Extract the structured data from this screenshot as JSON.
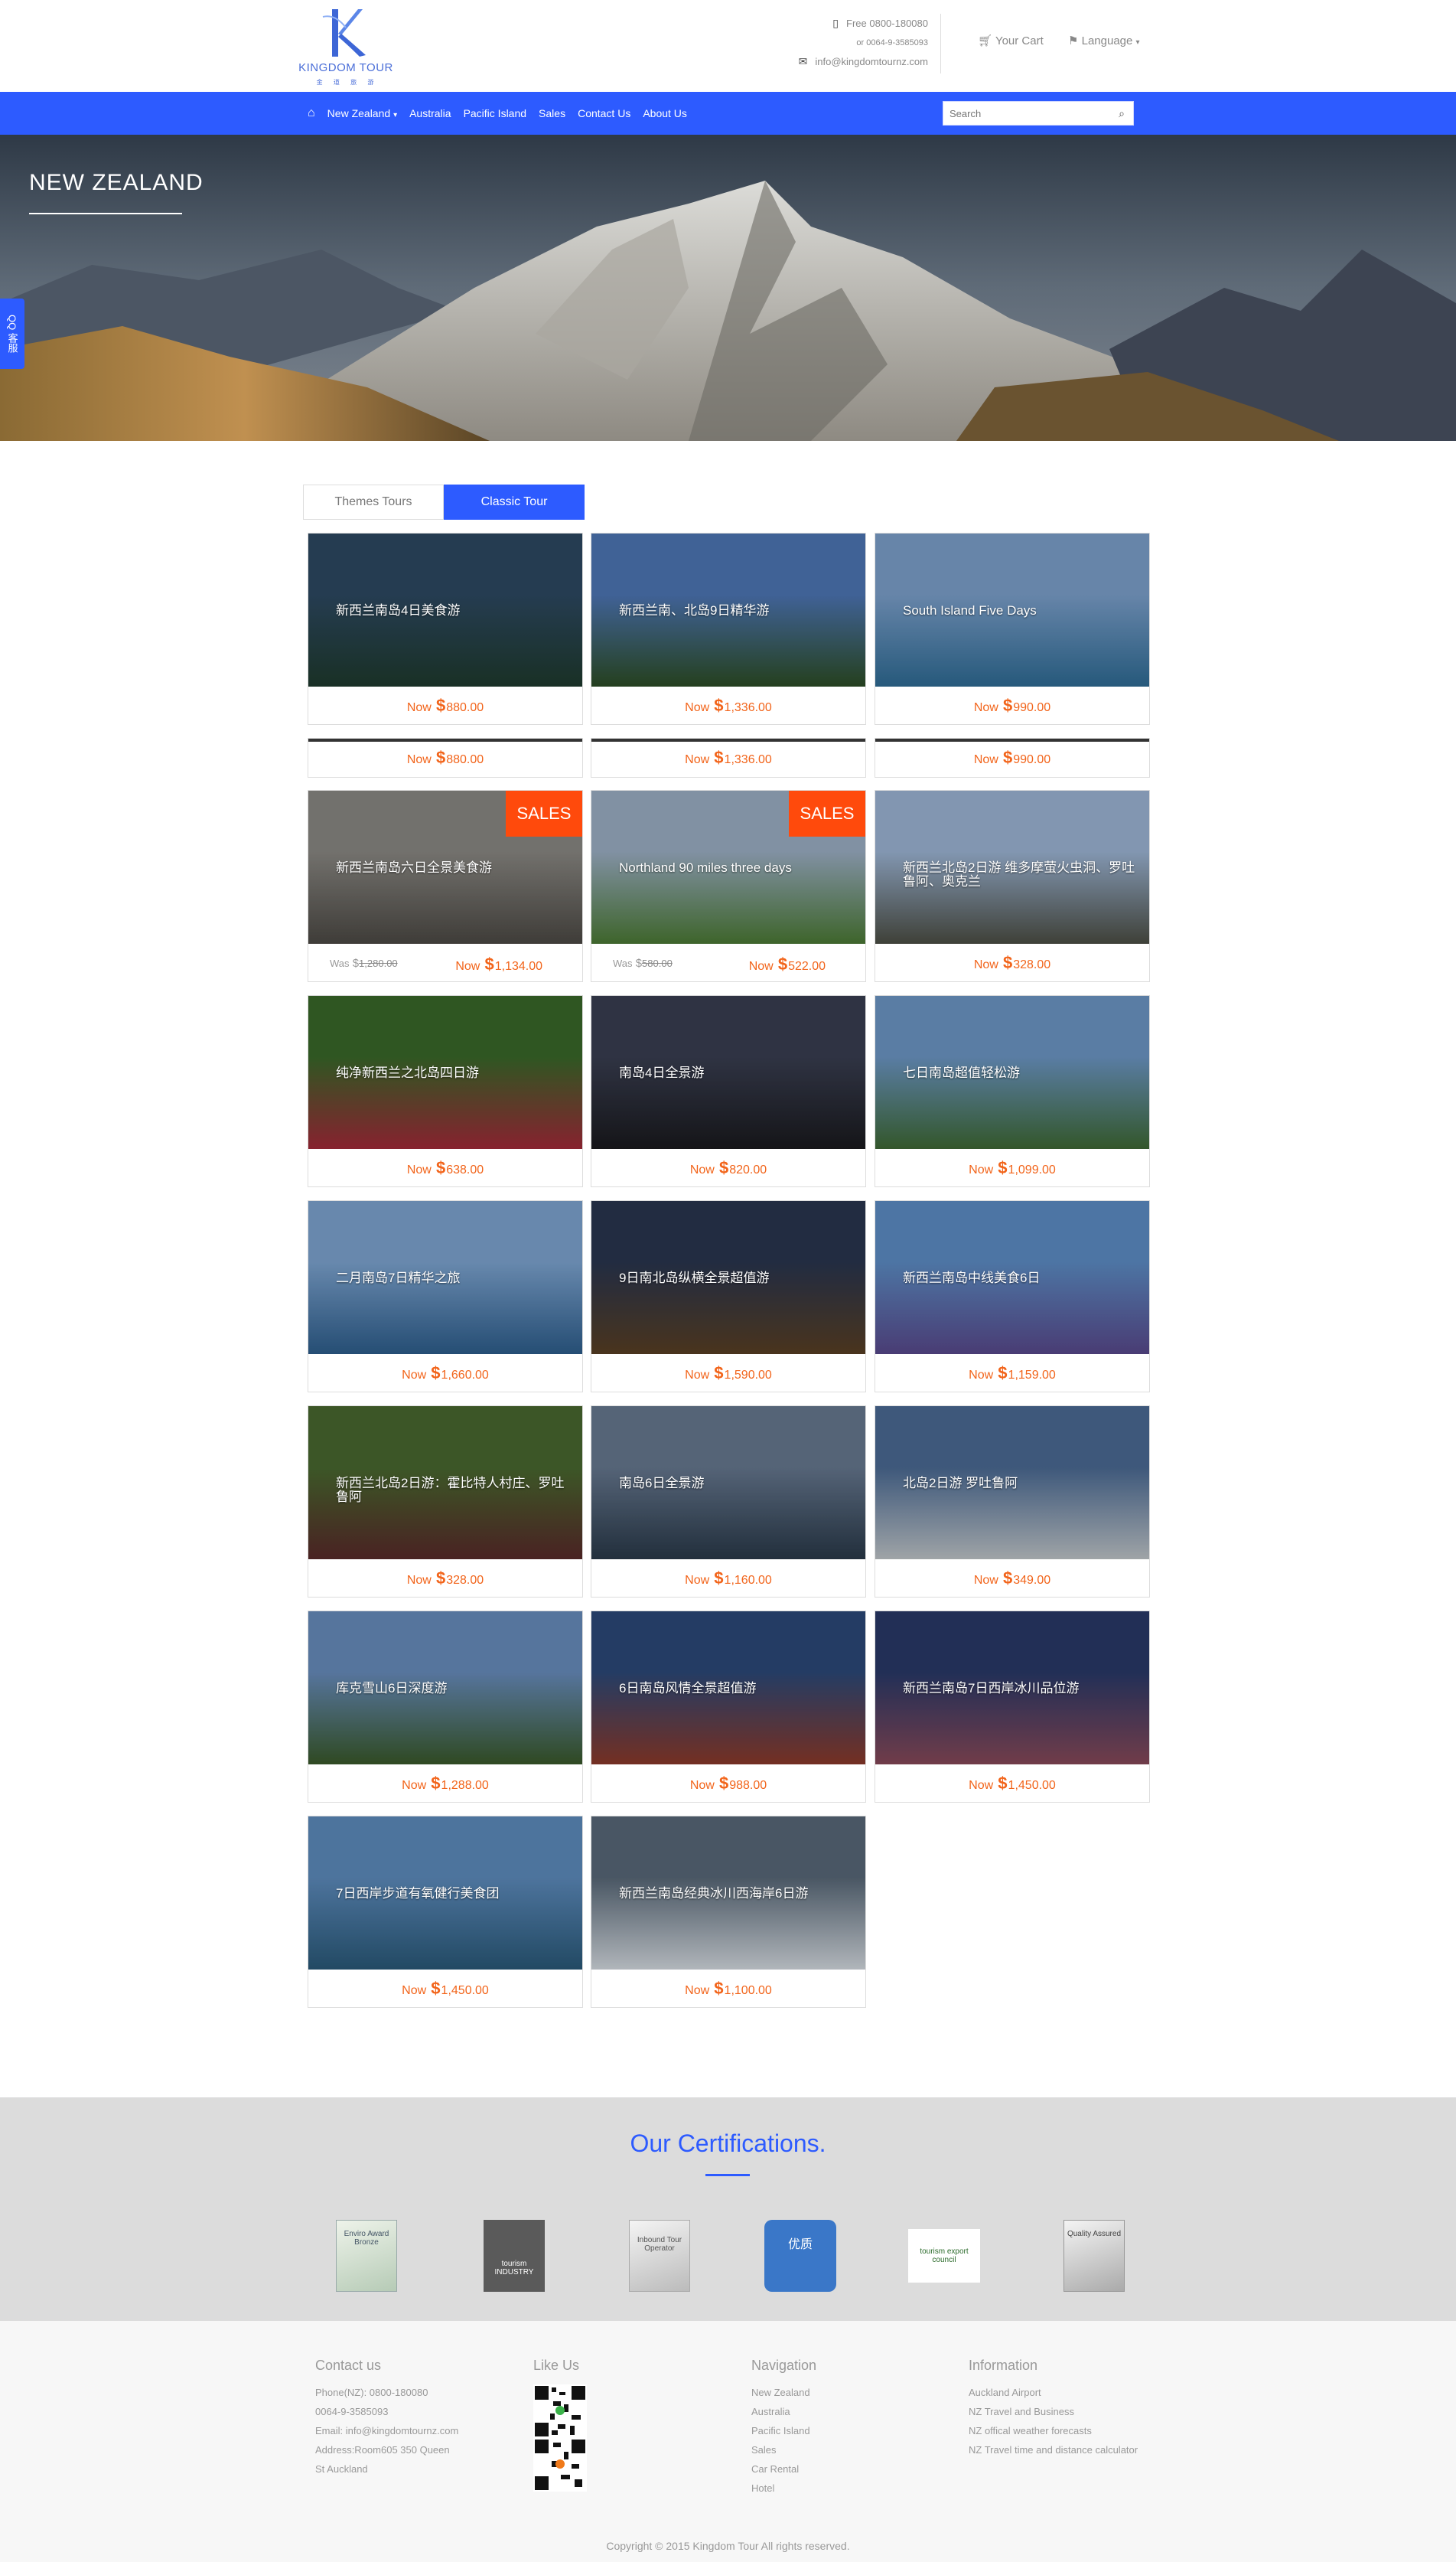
{
  "header": {
    "logo_text": "KINGDOM TOUR",
    "logo_sub": "金 道 旅 游",
    "phone_label": "Free 0800-180080",
    "phone_alt": "or 0064-9-3585093",
    "email": "info@kingdomtournz.com",
    "cart_label": "Your Cart",
    "language_label": "Language"
  },
  "nav": {
    "items": [
      "New Zealand",
      "Australia",
      "Pacific Island",
      "Sales",
      "Contact Us",
      "About Us"
    ],
    "search_placeholder": "Search"
  },
  "hero": {
    "title": "NEW ZEALAND",
    "qq_tab": "QQ 客服"
  },
  "tabs": [
    "Themes Tours",
    "Classic Tour"
  ],
  "price_prefix": "Now",
  "was_prefix": "Was",
  "sales_label": "SALES",
  "tours": [
    {
      "title": "新西兰南岛4日美食游",
      "price": "880.00",
      "colors": [
        "#2e4a63",
        "#1f3b2e"
      ]
    },
    {
      "title": "新西兰南、北岛9日精华游",
      "price": "1,336.00",
      "colors": [
        "#4f78b8",
        "#2d4e25"
      ]
    },
    {
      "title": "South Island Five Days",
      "price": "990.00",
      "colors": [
        "#7ea3cf",
        "#2f6d97"
      ]
    },
    {
      "title": "",
      "price": "880.00",
      "short": true
    },
    {
      "title": "",
      "price": "1,336.00",
      "short": true
    },
    {
      "title": "",
      "price": "990.00",
      "short": true
    },
    {
      "title": "新西兰南岛六日全景美食游",
      "price": "1,134.00",
      "was": "1,280.00",
      "sale": true,
      "colors": [
        "#8c8a85",
        "#4d4a45"
      ]
    },
    {
      "title": "Northland 90 miles three days",
      "price": "522.00",
      "was": "580.00",
      "sale": true,
      "colors": [
        "#9eb1c7",
        "#4c7b35"
      ]
    },
    {
      "title": "新西兰北岛2日游 维多摩萤火虫洞、罗吐鲁阿、奥克兰",
      "price": "328.00",
      "colors": [
        "#9fb8d8",
        "#4d4f45"
      ]
    },
    {
      "title": "纯净新西兰之北岛四日游",
      "price": "638.00",
      "colors": [
        "#3a6a2a",
        "#a52a3a"
      ]
    },
    {
      "title": "南岛4日全景游",
      "price": "820.00",
      "colors": [
        "#3a3f52",
        "#1a1a1e"
      ]
    },
    {
      "title": "七日南岛超值轻松游",
      "price": "1,099.00",
      "colors": [
        "#6e99c8",
        "#3f6a35"
      ]
    },
    {
      "title": "二月南岛7日精华之旅",
      "price": "1,660.00",
      "colors": [
        "#7fa7d4",
        "#2e5f8e"
      ]
    },
    {
      "title": "9日南北岛纵横全景超值游",
      "price": "1,590.00",
      "colors": [
        "#2a3650",
        "#5a4024"
      ]
    },
    {
      "title": "新西兰南岛中线美食6日",
      "price": "1,159.00",
      "colors": [
        "#5e8fc8",
        "#5a4a8e"
      ]
    },
    {
      "title": "新西兰北岛2日游：霍比特人村庄、罗吐鲁阿",
      "price": "328.00",
      "colors": [
        "#4a6a30",
        "#5a2a2a"
      ]
    },
    {
      "title": "南岛6日全景游",
      "price": "1,160.00",
      "colors": [
        "#687a92",
        "#2a3a4a"
      ]
    },
    {
      "title": "北岛2日游 罗吐鲁阿",
      "price": "349.00",
      "colors": [
        "#4c6c96",
        "#c2c8cc"
      ]
    },
    {
      "title": "库克雪山6日深度游",
      "price": "1,288.00",
      "colors": [
        "#6a8fc0",
        "#3a5a2a"
      ]
    },
    {
      "title": "6日南岛风情全景超值游",
      "price": "988.00",
      "colors": [
        "#2d4a7a",
        "#8e3a2a"
      ]
    },
    {
      "title": "新西兰南岛7日西岸冰川品位游",
      "price": "1,450.00",
      "colors": [
        "#2a3a6a",
        "#8a4a5a"
      ]
    },
    {
      "title": "7日西岸步道有氧健行美食团",
      "price": "1,450.00",
      "colors": [
        "#5f8ec0",
        "#2a5a7a"
      ]
    },
    {
      "title": "新西兰南岛经典冰川西海岸6日游",
      "price": "1,100.00",
      "colors": [
        "#5a6a7a",
        "#d8dee4"
      ]
    }
  ],
  "certifications": {
    "title": "Our Certifications.",
    "badges": [
      "Enviro Award Bronze",
      "tourism INDUSTRY",
      "Inbound Tour Operator",
      "优质",
      "tourism export council",
      "Quality Assured"
    ]
  },
  "footer": {
    "contact": {
      "heading": "Contact us",
      "lines": [
        "Phone(NZ): 0800-180080",
        "0064-9-3585093",
        "Email: info@kingdomtournz.com",
        "Address:Room605 350 Queen",
        "St Auckland"
      ]
    },
    "like": {
      "heading": "Like Us"
    },
    "navigation": {
      "heading": "Navigation",
      "lines": [
        "New Zealand",
        "Australia",
        "Pacific Island",
        "Sales",
        "Car Rental",
        "Hotel"
      ]
    },
    "information": {
      "heading": "Information",
      "lines": [
        "Auckland Airport",
        "NZ Travel and Business",
        "NZ offical weather forecasts",
        "NZ Travel time and distance calculator"
      ]
    },
    "copyright": "Copyright © 2015 Kingdom Tour All rights reserved."
  },
  "colors": {
    "brand": "#2d5bff",
    "price": "#f2641a",
    "sales": "#ff4a0c"
  }
}
